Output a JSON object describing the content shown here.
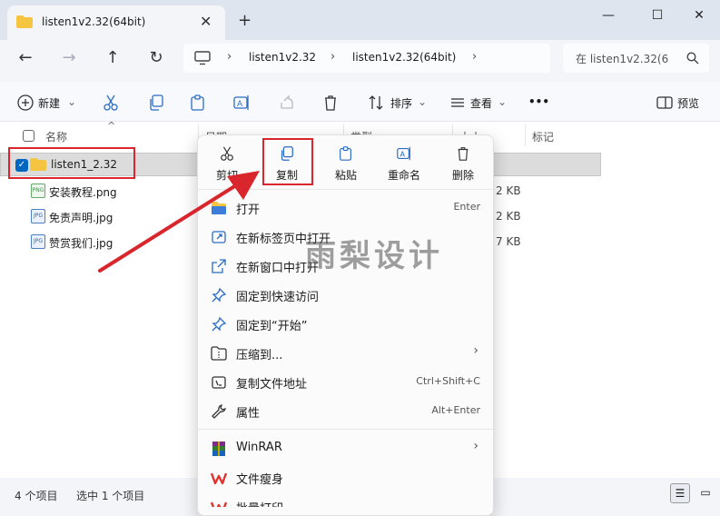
{
  "window": {
    "tab_title": "listen1v2.32(64bit)",
    "new_tab": "+",
    "close_tab": "✕"
  },
  "address": {
    "segments": [
      "listen1v2.32",
      "listen1v2.32(64bit)"
    ],
    "search_placeholder": "在 listen1v2.32(6"
  },
  "toolbar": {
    "new_label": "新建",
    "sort_label": "排序",
    "view_label": "查看",
    "more_label": "•••",
    "preview_label": "预览"
  },
  "columns": {
    "name": "名称",
    "date": "日期",
    "type": "类型",
    "size": "大小",
    "tags": "标记"
  },
  "files": [
    {
      "name": "listen1_2.32",
      "size": "",
      "type": "folder"
    },
    {
      "name": "安装教程.png",
      "size": "2 KB",
      "type": "png"
    },
    {
      "name": "免责声明.jpg",
      "size": "2 KB",
      "type": "jpg"
    },
    {
      "name": "赞赏我们.jpg",
      "size": "7 KB",
      "type": "jpg"
    }
  ],
  "context_menu": {
    "top_actions": [
      {
        "label": "剪切",
        "icon": "scissors-icon"
      },
      {
        "label": "复制",
        "icon": "copy-icon"
      },
      {
        "label": "粘贴",
        "icon": "paste-icon"
      },
      {
        "label": "重命名",
        "icon": "rename-icon"
      },
      {
        "label": "删除",
        "icon": "trash-icon"
      }
    ],
    "items": [
      {
        "label": "打开",
        "shortcut": "Enter"
      },
      {
        "label": "在新标签页中打开",
        "shortcut": ""
      },
      {
        "label": "在新窗口中打开",
        "shortcut": ""
      },
      {
        "label": "固定到快速访问",
        "shortcut": ""
      },
      {
        "label": "固定到“开始”",
        "shortcut": ""
      },
      {
        "label": "压缩到...",
        "shortcut": ""
      },
      {
        "label": "复制文件地址",
        "shortcut": "Ctrl+Shift+C"
      },
      {
        "label": "属性",
        "shortcut": "Alt+Enter"
      },
      {
        "label": "WinRAR",
        "shortcut": ""
      },
      {
        "label": "文件瘦身",
        "shortcut": ""
      },
      {
        "label": "批量打印",
        "shortcut": ""
      }
    ]
  },
  "status": {
    "count": "4 个项目",
    "selected": "选中 1 个项目"
  },
  "watermark": "雨梨设计",
  "colors": {
    "accent": "#0067c0",
    "highlight": "#d9252c",
    "folder": "#f5c542"
  }
}
